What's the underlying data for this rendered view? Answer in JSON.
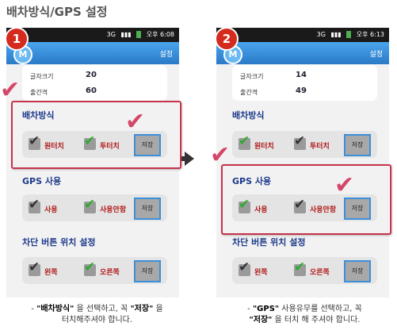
{
  "page_title": "배차방식/GPS 설정",
  "status_bar": {
    "time_text": "오후 6:08",
    "time_text_2": "오후 6:13"
  },
  "app_bar": {
    "logo": "M",
    "setting_label": "설정"
  },
  "steps": [
    "1",
    "2"
  ],
  "info": {
    "font_size_label": "글자크기",
    "font_size_value": "20",
    "font_size_value_2": "14",
    "interval_label": "출간격",
    "interval_value": "60",
    "interval_value_2": "49"
  },
  "dispatch": {
    "title": "배차방식",
    "option_a": "원터치",
    "option_b": "투터치",
    "save": "저장"
  },
  "gps": {
    "title": "GPS 사용",
    "option_a": "사용",
    "option_b": "사용안함",
    "save": "저장"
  },
  "button_pos": {
    "title": "차단 버튼 위치 설정",
    "option_a": "왼쪽",
    "option_b": "오른쪽",
    "save": "저장"
  },
  "captions": {
    "left_line1_prefix": "- ",
    "left_line1_bold1": "\"배차방식\"",
    "left_line1_mid": " 을 선택하고, 꼭 ",
    "left_line1_bold2": "\"저장\"",
    "left_line1_end": " 을",
    "left_line2": "터치해주셔야 합니다.",
    "right_line1_prefix": "- ",
    "right_line1_bold": "\"GPS\"",
    "right_line1_end": " 사용유무를 선택하고, 꼭",
    "right_line2_bold": "\"저장\"",
    "right_line2_end": " 을 터치 해 주셔야 합니다."
  }
}
